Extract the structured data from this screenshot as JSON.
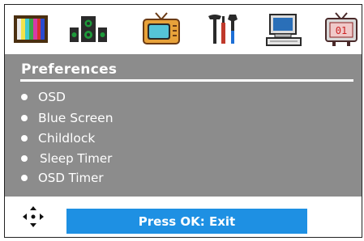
{
  "header": {
    "icons": [
      "color-bars-icon",
      "speakers-icon",
      "tv-icon",
      "tools-icon",
      "computer-icon",
      "clock-tv-icon"
    ]
  },
  "menu": {
    "title": "Preferences",
    "items": [
      {
        "label": "OSD"
      },
      {
        "label": "Blue Screen"
      },
      {
        "label": "Childlock"
      },
      {
        "label": "Sleep Timer"
      },
      {
        "label": "OSD Timer"
      }
    ]
  },
  "footer": {
    "hint": "Press OK: Exit"
  },
  "colors": {
    "panel_bg": "#8c8c8c",
    "accent_bar": "#1e90e3",
    "text": "#ffffff"
  }
}
